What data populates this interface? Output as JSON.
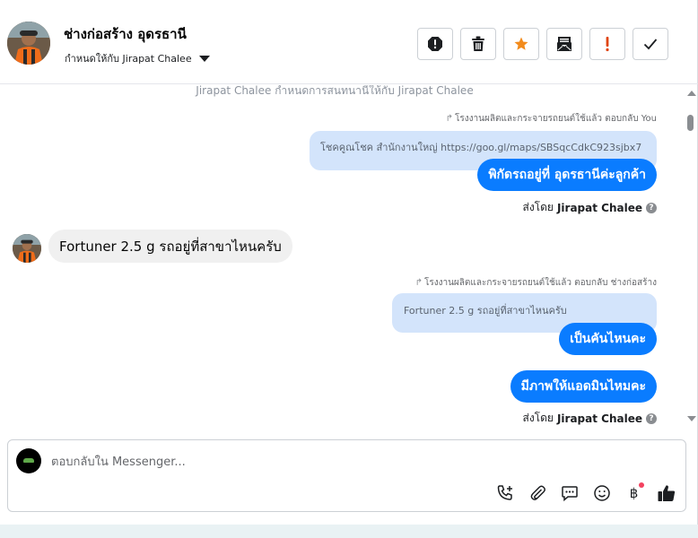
{
  "header": {
    "contact_name": "ช่างก่อสร้าง อุดรธานี",
    "assigned_to": "กำหนดให้กับ Jirapat Chalee",
    "actions": [
      {
        "name": "report-spam-button",
        "icon": "exclamation-octagon-icon"
      },
      {
        "name": "delete-button",
        "icon": "trash-icon"
      },
      {
        "name": "star-button",
        "icon": "star-icon",
        "color": "#f28b1c"
      },
      {
        "name": "mark-unread-button",
        "icon": "envelope-icon"
      },
      {
        "name": "follow-up-button",
        "icon": "exclamation-icon",
        "color": "#e0440e"
      },
      {
        "name": "mark-done-button",
        "icon": "check-icon"
      }
    ]
  },
  "conversation": {
    "system_note": "Jirapat Chalee กำหนดการสนทนานี้ให้กับ Jirapat Chalee",
    "group1": {
      "reply_meta": "โรงงานผลิตและกระจายรถยนต์ใช้แล้ว ตอบกลับ You",
      "quoted": "โชคคูณโชค สำนักงานใหญ่ https://goo.gl/maps/SBSqcCdkC923sjbx7",
      "bubble": "พิกัดรถอยู่ที่ อุดรธานีค่ะลูกค้า",
      "sent_by_prefix": "ส่งโดย",
      "sent_by_name": "Jirapat Chalee"
    },
    "incoming": {
      "text": "Fortuner 2.5 g  รถอยู่ที่สาขาไหนครับ"
    },
    "group2": {
      "reply_meta": "โรงงานผลิตและกระจายรถยนต์ใช้แล้ว ตอบกลับ ช่างก่อสร้าง",
      "quoted": "Fortuner 2.5 g รถอยู่ที่สาขาไหนครับ",
      "bubble1": "เป็นคันไหนคะ",
      "bubble2": "มีภาพให้แอดมินไหมคะ",
      "sent_by_prefix": "ส่งโดย",
      "sent_by_name": "Jirapat Chalee"
    }
  },
  "composer": {
    "placeholder": "ตอบกลับใน Messenger...",
    "tools": [
      "call-add-icon",
      "paperclip-icon",
      "saved-reply-icon",
      "emoji-icon",
      "payment-baht-icon",
      "thumbs-up-icon"
    ],
    "baht_symbol": "฿"
  },
  "colors": {
    "accent": "#0a7cff",
    "quoted_bg": "#d3e4fb",
    "incoming_bg": "#f0f0f0"
  }
}
